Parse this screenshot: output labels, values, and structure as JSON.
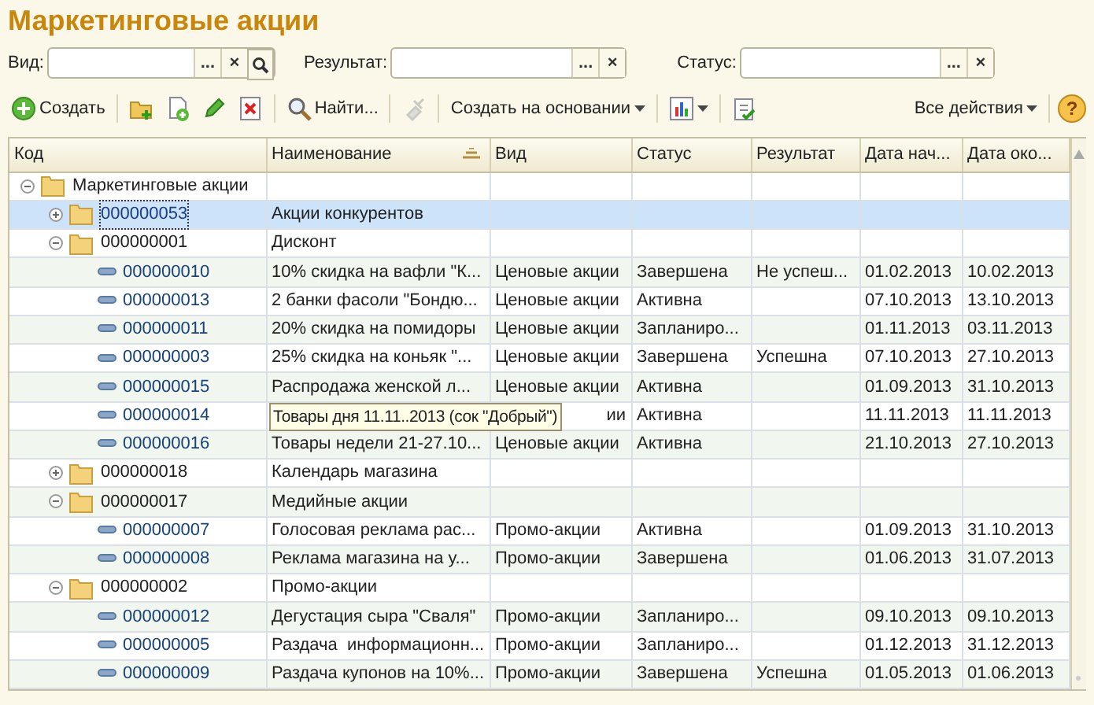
{
  "window": {
    "title": "Маркетинговые акции"
  },
  "filters": [
    {
      "label": "Вид:",
      "buttons": [
        "...",
        "×"
      ],
      "search": true
    },
    {
      "label": "Результат:",
      "buttons": [
        "...",
        "×"
      ],
      "search": false
    },
    {
      "label": "Статус:",
      "buttons": [
        "...",
        "×"
      ],
      "search": false
    }
  ],
  "toolbar": [
    {
      "kind": "icon-text",
      "label": "Создать"
    },
    {
      "kind": "sep"
    },
    {
      "kind": "icon"
    },
    {
      "kind": "icon"
    },
    {
      "kind": "icon"
    },
    {
      "kind": "icon"
    },
    {
      "kind": "sep"
    },
    {
      "kind": "icon-text",
      "label": "Найти..."
    },
    {
      "kind": "sep"
    },
    {
      "kind": "icon",
      "disabled": true
    },
    {
      "kind": "sep"
    },
    {
      "kind": "menu",
      "label": "Создать на основании"
    },
    {
      "kind": "sep"
    },
    {
      "kind": "icon-menu"
    },
    {
      "kind": "sep"
    },
    {
      "kind": "icon"
    },
    {
      "kind": "spacer"
    },
    {
      "kind": "menu",
      "label": "Все действия"
    },
    {
      "kind": "sep"
    },
    {
      "kind": "help",
      "label": "?"
    }
  ],
  "table": {
    "columns": [
      "Код",
      "Наименование",
      "Вид",
      "Статус",
      "Результат",
      "Дата нач...",
      "Дата око..."
    ],
    "rows": [
      {
        "kind": "group",
        "code": "Маркетинговые акции",
        "expanded": true,
        "selected": false,
        "children": [
          {
            "kind": "group",
            "code": "000000053",
            "name": "Акции конкурентов",
            "expanded": false,
            "selected": true
          },
          {
            "kind": "group",
            "code": "000000001",
            "name": "Дисконт",
            "expanded": true,
            "selected": false,
            "children": [
              {
                "kind": "item",
                "code": "000000010",
                "name": "10% скидка на вафли \"К...",
                "vid": "Ценовые акции",
                "status": "Завершена",
                "result": "Не успеш...",
                "start": "01.02.2013",
                "end": "10.02.2013",
                "selected": false
              },
              {
                "kind": "item",
                "code": "000000013",
                "name": "2 банки фасоли \"Бондю...",
                "vid": "Ценовые акции",
                "status": "Активна",
                "start": "07.10.2013",
                "end": "13.10.2013",
                "selected": false
              },
              {
                "kind": "item",
                "code": "000000011",
                "name": "20% скидка на помидоры",
                "vid": "Ценовые акции",
                "status": "Запланиро...",
                "start": "01.11.2013",
                "end": "03.11.2013",
                "selected": false
              },
              {
                "kind": "item",
                "code": "000000003",
                "name": "25% скидка на коньяк \"...",
                "vid": "Ценовые акции",
                "status": "Завершена",
                "result": "Успешна",
                "start": "07.10.2013",
                "end": "27.10.2013",
                "selected": false
              },
              {
                "kind": "item",
                "code": "000000015",
                "name": "Распродажа женской л...",
                "vid": "Ценовые акции",
                "status": "Активна",
                "start": "01.09.2013",
                "end": "31.10.2013",
                "selected": false
              },
              {
                "kind": "item",
                "code": "000000014",
                "tooltip": "Товары дня 11.11..2013 (сок \"Добрый\")",
                "vid": "ии",
                "status": "Активна",
                "start": "11.11.2013",
                "end": "11.11.2013",
                "selected": false
              },
              {
                "kind": "item",
                "code": "000000016",
                "name": "Товары недели 21-27.10...",
                "vid": "Ценовые акции",
                "status": "Активна",
                "start": "21.10.2013",
                "end": "27.10.2013",
                "selected": false
              }
            ]
          },
          {
            "kind": "group",
            "code": "000000018",
            "name": "Календарь магазина",
            "expanded": false,
            "selected": false
          },
          {
            "kind": "group",
            "code": "000000017",
            "name": "Медийные акции",
            "expanded": true,
            "selected": false,
            "children": [
              {
                "kind": "item",
                "code": "000000007",
                "name": "Голосовая реклама рас...",
                "vid": "Промо-акции",
                "status": "Активна",
                "start": "01.09.2013",
                "end": "31.10.2013",
                "selected": false
              },
              {
                "kind": "item",
                "code": "000000008",
                "name": "Реклама магазина на у...",
                "vid": "Промо-акции",
                "status": "Завершена",
                "start": "01.06.2013",
                "end": "31.07.2013",
                "selected": false
              }
            ]
          },
          {
            "kind": "group",
            "code": "000000002",
            "name": "Промо-акции",
            "expanded": true,
            "selected": false,
            "children": [
              {
                "kind": "item",
                "code": "000000012",
                "name": "Дегустация сыра \"Сваля\"",
                "vid": "Промо-акции",
                "status": "Запланиро...",
                "start": "09.10.2013",
                "end": "09.10.2013",
                "selected": false
              },
              {
                "kind": "item",
                "code": "000000005",
                "name": "Раздача  информационн...",
                "vid": "Промо-акции",
                "status": "Запланиро...",
                "start": "01.12.2013",
                "end": "31.12.2013",
                "selected": false
              },
              {
                "kind": "item",
                "code": "000000009",
                "name": "Раздача купонов на 10%...",
                "vid": "Промо-акции",
                "status": "Завершена",
                "result": "Успешна",
                "start": "01.05.2013",
                "end": "01.06.2013",
                "selected": false
              }
            ]
          }
        ]
      }
    ]
  }
}
